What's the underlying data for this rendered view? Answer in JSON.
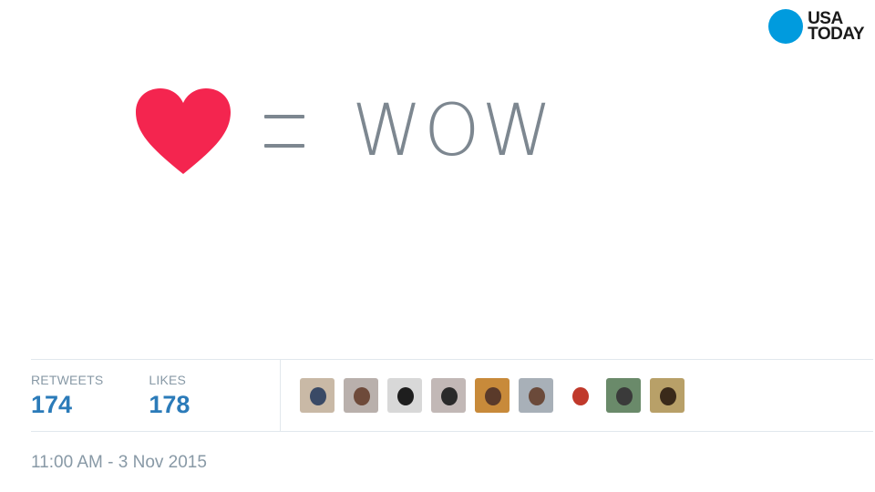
{
  "logo": {
    "line1": "USA",
    "line2": "TODAY",
    "circle_color": "#009bde"
  },
  "equation": {
    "icon": "heart-icon",
    "operator": "=",
    "word": "WOW",
    "heart_color": "#f4254f"
  },
  "stats": {
    "retweets_label": "RETWEETS",
    "retweets_value": "174",
    "likes_label": "LIKES",
    "likes_value": "178"
  },
  "avatars": [
    {
      "bg": "#c9b9a6",
      "face": "#3a4a66"
    },
    {
      "bg": "#b9b0ac",
      "face": "#6e4a3a"
    },
    {
      "bg": "#d8d8d8",
      "face": "#1e1e1e"
    },
    {
      "bg": "#c2b8b6",
      "face": "#2a2a2a"
    },
    {
      "bg": "#c88a3a",
      "face": "#5a3a2a"
    },
    {
      "bg": "#a8b0b8",
      "face": "#6b4a3a"
    },
    {
      "bg": "#ffffff",
      "face": "#c0392b"
    },
    {
      "bg": "#6a8a6a",
      "face": "#3a3a3a"
    },
    {
      "bg": "#b8a068",
      "face": "#3a2a1a"
    }
  ],
  "timestamp": "11:00 AM - 3 Nov 2015"
}
